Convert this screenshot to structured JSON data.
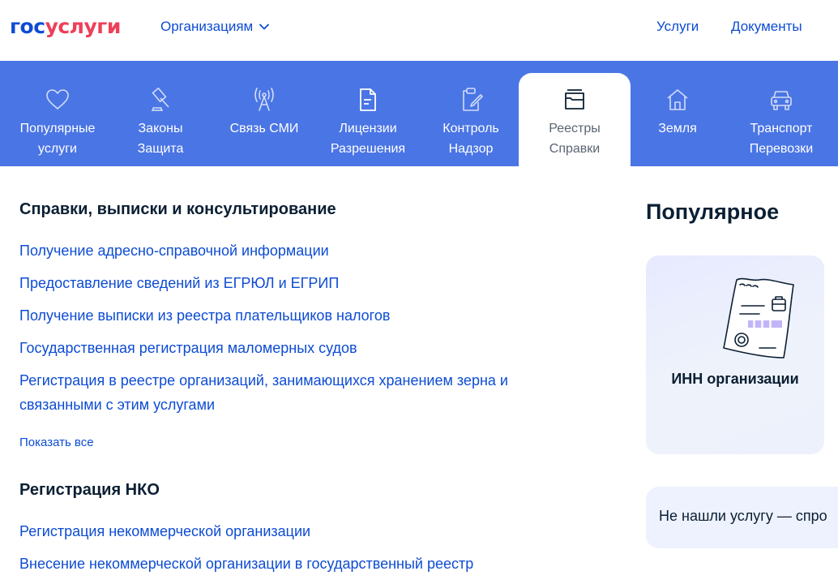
{
  "header": {
    "logo_gos": "гос",
    "logo_uslugi": "услуги",
    "org_menu": "Организациям",
    "links": {
      "services": "Услуги",
      "documents": "Документы"
    }
  },
  "categories": [
    {
      "line1": "Популярные",
      "line2": "услуги",
      "icon": "heart-icon"
    },
    {
      "line1": "Законы",
      "line2": "Защита",
      "icon": "gavel-icon"
    },
    {
      "line1": "Связь СМИ",
      "line2": "",
      "icon": "antenna-icon"
    },
    {
      "line1": "Лицензии",
      "line2": "Разрешения",
      "icon": "document-icon"
    },
    {
      "line1": "Контроль",
      "line2": "Надзор",
      "icon": "clipboard-edit-icon"
    },
    {
      "line1": "Реестры",
      "line2": "Справки",
      "icon": "folder-icon",
      "active": true
    },
    {
      "line1": "Земля",
      "line2": "",
      "icon": "house-icon"
    },
    {
      "line1": "Транспорт",
      "line2": "Перевозки",
      "icon": "car-icon"
    }
  ],
  "sections": {
    "references": {
      "title": "Справки, выписки и консультирование",
      "items": [
        "Получение адресно-справочной информации",
        "Предоставление сведений из ЕГРЮЛ и ЕГРИП",
        "Получение выписки из реестра плательщиков налогов",
        "Государственная регистрация маломерных судов",
        "Регистрация в реестре организаций, занимающихся хранением зерна и связанными с этим услугами"
      ],
      "show_all": "Показать все"
    },
    "nko": {
      "title": "Регистрация НКО",
      "items": [
        "Регистрация некоммерческой организации",
        "Внесение некоммерческой организации в государственный реестр"
      ]
    }
  },
  "sidebar": {
    "popular_title": "Популярное",
    "popular_card_label": "ИНН организации",
    "not_found": "Не нашли услугу — спро"
  },
  "colors": {
    "brand_blue": "#0d4cd3",
    "brand_red": "#ee3f58",
    "category_bar": "#4a75e5"
  }
}
